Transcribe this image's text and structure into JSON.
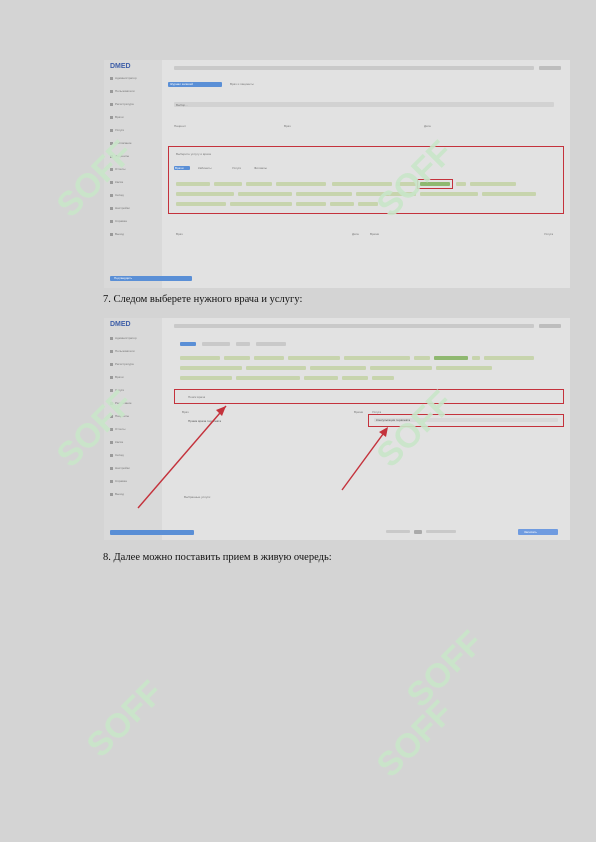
{
  "screen1": {
    "logo": "DMED",
    "sidebar": [
      "Администратор",
      "Пользователи",
      "Регистратура",
      "Врачи",
      "Услуги",
      "Расписание",
      "Пациенты",
      "Отчеты",
      "Касса",
      "Склад",
      "Настройки",
      "Справка",
      "Выход"
    ],
    "tab_active": "Журнал записей",
    "tab_other": "Врач и пациенты",
    "row_values": [
      "Выбор...",
      "Пациент",
      "Врач",
      "Дата"
    ],
    "select_hint": "Выберите услугу и врача",
    "chip_tabs": [
      "Врачи",
      "Кабинеты",
      "Услуги",
      "Филиалы"
    ],
    "list_headers": [
      "Врач",
      "Дата",
      "Время",
      "Услуга"
    ],
    "bottom_btn": "Подтвердить"
  },
  "caption7": "7.   Следом выберете нужного врача и услугу:",
  "screen2": {
    "logo": "DMED",
    "sidebar": [
      "Администратор",
      "Пользователи",
      "Регистратура",
      "Врачи",
      "Услуги",
      "Расписание",
      "Пациенты",
      "Отчеты",
      "Касса",
      "Склад",
      "Настройки",
      "Справка",
      "Выход"
    ],
    "search_field": "Поиск врача",
    "col_headers": [
      "Врач",
      "Время",
      "Услуга"
    ],
    "row_doctor": "Прием врача терапевта",
    "row_service": "Консультация терапевта",
    "selected_label": "Выбранные услуги:",
    "bottom_btn": "Записать"
  },
  "caption8": "8.   Далее можно поставить прием в живую очередь:",
  "watermark": "SOFF"
}
